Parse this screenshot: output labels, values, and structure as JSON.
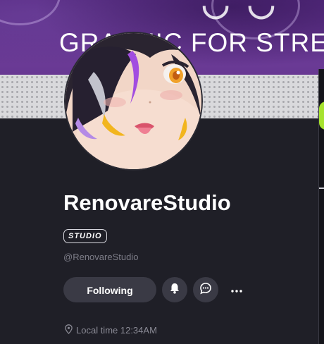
{
  "banner": {
    "text": "GRAPHIC FOR STRE"
  },
  "profile": {
    "display_name": "RenovareStudio",
    "badge": "STUDIO",
    "handle": "@RenovareStudio",
    "follow_label": "Following",
    "local_time": "Local time 12:34AM"
  },
  "icons": {
    "bell": "bell-icon",
    "chat": "chat-bubble-icon",
    "more": "more-dots-icon",
    "location": "location-pin-icon"
  },
  "colors": {
    "background": "#1f1f27",
    "banner_purple": "#5a2d86",
    "button_bg": "#3a3a45",
    "muted_text": "#7d7d88",
    "accent_green": "#a6e22e"
  }
}
